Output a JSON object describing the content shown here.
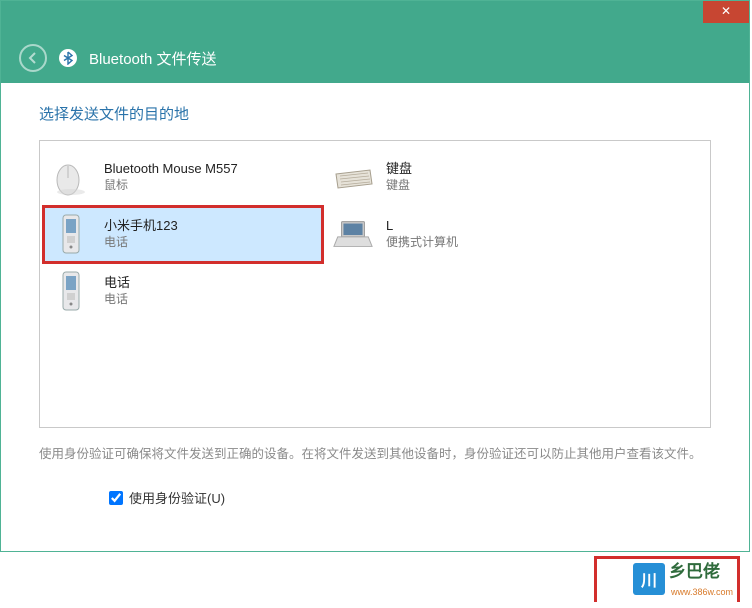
{
  "titlebar": {
    "close_symbol": "✕"
  },
  "header": {
    "title": "Bluetooth 文件传送"
  },
  "section": {
    "title": "选择发送文件的目的地"
  },
  "devices": [
    {
      "name": "Bluetooth Mouse M557",
      "type": "鼠标"
    },
    {
      "name": "键盘",
      "type": "键盘"
    },
    {
      "name": "小米手机123",
      "type": "电话"
    },
    {
      "name": "L",
      "type": "便携式计算机"
    },
    {
      "name": "电话",
      "type": "电话"
    }
  ],
  "hint": "使用身份验证可确保将文件发送到正确的设备。在将文件发送到其他设备时，身份验证还可以防止其他用户查看该文件。",
  "auth": {
    "label": "使用身份验证(U)",
    "checked": true
  },
  "watermark": {
    "logo_letter": "川",
    "text": "乡巴佬",
    "url": "www.386w.com"
  }
}
